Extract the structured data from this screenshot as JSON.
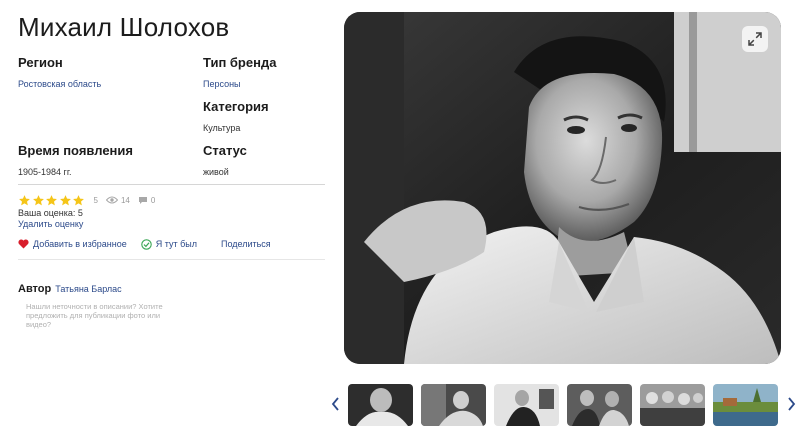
{
  "page": {
    "title": "Михаил Шолохов"
  },
  "details": {
    "region_label": "Регион",
    "region_value": "Ростовская область",
    "brand_type_label": "Тип бренда",
    "brand_type_value": "Персоны",
    "category_label": "Категория",
    "category_value": "Культура",
    "period_label": "Время появления",
    "period_value": "1905-1984 гг.",
    "status_label": "Статус",
    "status_value": "живой"
  },
  "rating": {
    "stars": 5,
    "max_stars": 5,
    "score": "5",
    "views": "14",
    "comments": "0",
    "star_color": "#f5c518",
    "your_rating": "Ваша оценка: 5",
    "remove_rating": "Удалить оценку"
  },
  "actions": {
    "favorite": "Добавить в избранное",
    "visited": "Я тут был",
    "share": "Поделиться"
  },
  "author": {
    "label": "Автор",
    "name": "Татьяна Барлас"
  },
  "hint": {
    "text": "Нашли неточности в описании? Хотите предложить для публикации фото или видео?"
  },
  "gallery": {
    "main_photo_icon": "expand-icon",
    "thumbnail_count": 6,
    "prev_icon": "chevron-left-icon",
    "next_icon": "chevron-right-icon"
  },
  "colors": {
    "link": "#2c4a8a",
    "favorite_heart": "#d81e2c",
    "visited_check": "#3aa655"
  }
}
